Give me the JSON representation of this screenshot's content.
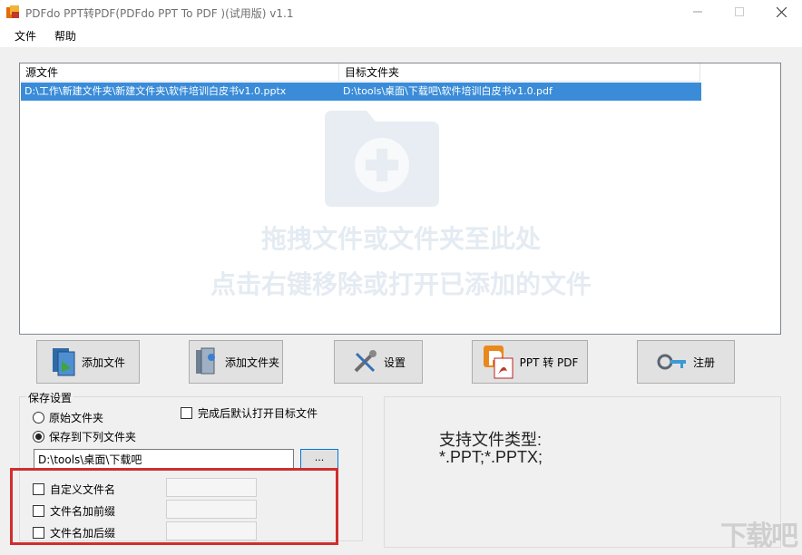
{
  "window": {
    "title": "PDFdo PPT转PDF(PDFdo PPT To PDF )(试用版) v1.1"
  },
  "menu": {
    "file": "文件",
    "help": "帮助"
  },
  "file_list": {
    "columns": [
      "源文件",
      "目标文件夹"
    ],
    "rows": [
      {
        "source": "D:\\工作\\新建文件夹\\新建文件夹\\软件培训白皮书v1.0.pptx",
        "target": "D:\\tools\\桌面\\下载吧\\软件培训白皮书v1.0.pdf"
      }
    ],
    "drop_hint_1": "拖拽文件或文件夹至此处",
    "drop_hint_2": "点击右键移除或打开已添加的文件"
  },
  "toolbar": {
    "add_file": "添加文件",
    "add_folder": "添加文件夹",
    "settings": "设置",
    "convert": "PPT 转 PDF",
    "register": "注册"
  },
  "save_settings": {
    "legend": "保存设置",
    "original_folder": "原始文件夹",
    "save_to_folder": "保存到下列文件夹",
    "selected": "save_to_folder",
    "open_after": "完成后默认打开目标文件",
    "path_value": "D:\\tools\\桌面\\下载吧",
    "browse_label": "...",
    "custom_name": "自定义文件名",
    "add_prefix": "文件名加前缀",
    "add_suffix": "文件名加后缀"
  },
  "info": {
    "supported_title": "支持文件类型:",
    "supported_types": "*.PPT;*.PPTX;"
  },
  "watermark": "下载吧",
  "colors": {
    "selection": "#3a8cd8",
    "highlight_box": "#cf2e2e"
  }
}
